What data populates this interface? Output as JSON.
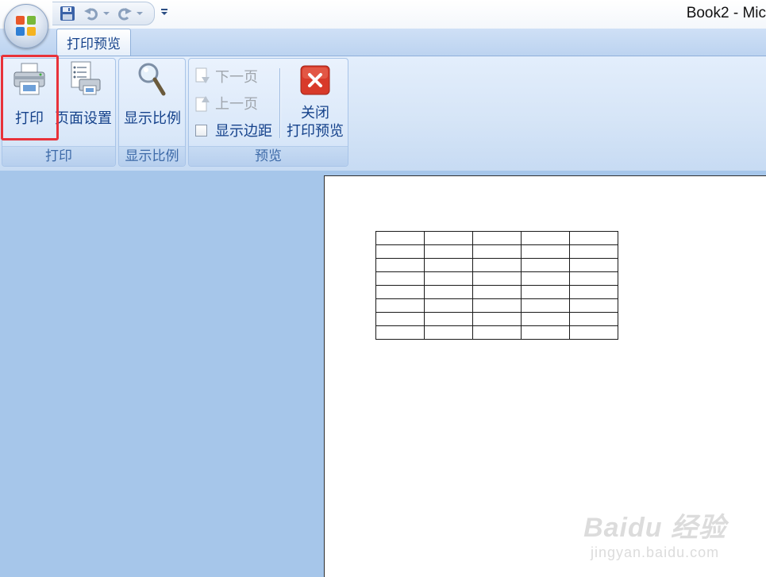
{
  "window": {
    "title": "Book2 - Mic"
  },
  "tabs": [
    {
      "label": "打印预览",
      "active": true
    }
  ],
  "ribbon": {
    "groups": [
      {
        "label": "打印",
        "buttons": [
          {
            "label": "打印",
            "icon": "printer-icon"
          },
          {
            "label": "页面设置",
            "icon": "page-setup-icon"
          }
        ]
      },
      {
        "label": "显示比例",
        "buttons": [
          {
            "label": "显示比例",
            "icon": "magnifier-icon"
          }
        ]
      },
      {
        "label": "预览",
        "small_buttons": [
          {
            "label": "下一页",
            "icon": "next-page-icon",
            "enabled": false
          },
          {
            "label": "上一页",
            "icon": "previous-page-icon",
            "enabled": false
          }
        ],
        "checkbox": {
          "label": "显示边距",
          "checked": false
        },
        "close_button": {
          "line1": "关闭",
          "line2": "打印预览",
          "icon": "close-x-icon"
        }
      }
    ]
  },
  "preview": {
    "table_rows": 8,
    "table_cols": 5
  },
  "watermark": {
    "brand": "Baidu 经验",
    "url": "jingyan.baidu.com"
  },
  "colors": {
    "ribbon_text": "#15428b",
    "highlight": "#e8323a",
    "preview_bg": "#a6c6ea"
  }
}
